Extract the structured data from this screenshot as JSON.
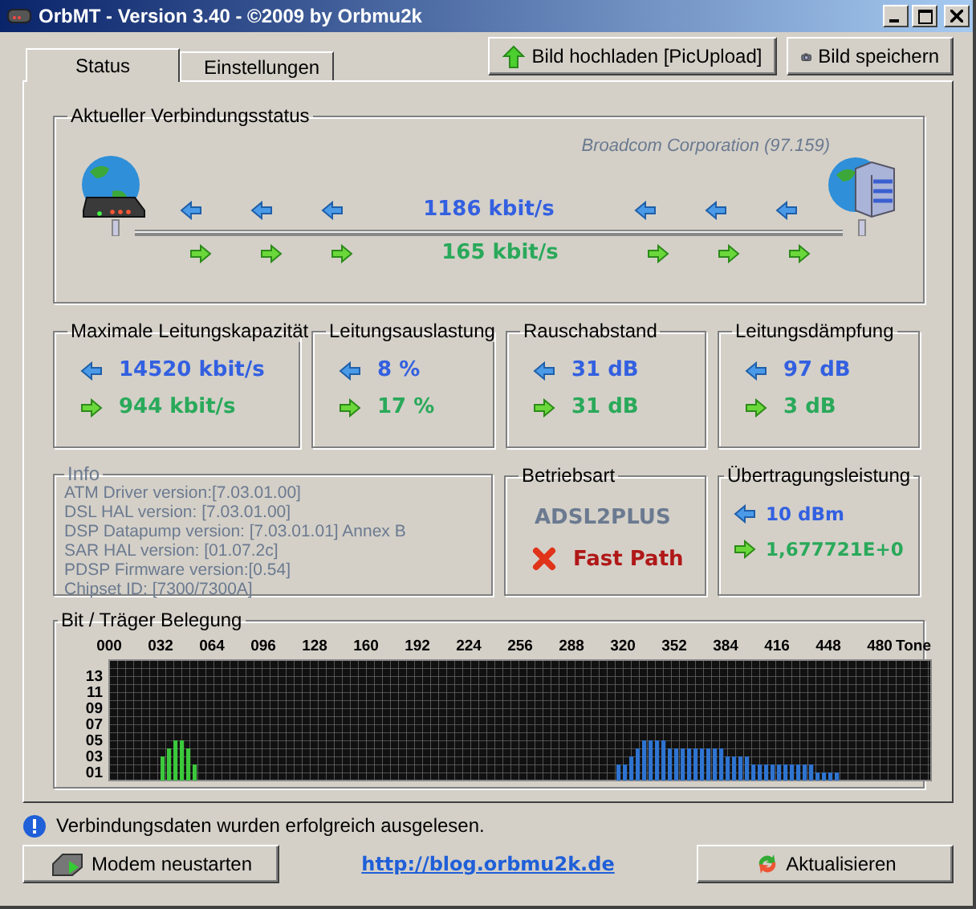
{
  "window": {
    "title": "OrbMT - Version 3.40 - ©2009 by Orbmu2k"
  },
  "tabs": [
    {
      "label": "Status",
      "selected": true
    },
    {
      "label": "Einstellungen",
      "selected": false
    }
  ],
  "toolbar_buttons": [
    {
      "label": "Bild hochladen [PicUpload]",
      "kind": "upload"
    },
    {
      "label": "Bild speichern",
      "kind": "camera"
    }
  ],
  "connection": {
    "title": "Aktueller Verbindungsstatus",
    "chipset": "Broadcom Corporation (97.159)",
    "downstream": "1186 kbit/s",
    "upstream": "165 kbit/s"
  },
  "metrics": [
    {
      "title": "Maximale Leitungskapazität",
      "down": "14520 kbit/s",
      "up": "944 kbit/s"
    },
    {
      "title": "Leitungsauslastung",
      "down": "8 %",
      "up": "17 %"
    },
    {
      "title": "Rauschabstand",
      "down": "31 dB",
      "up": "31 dB"
    },
    {
      "title": "Leitungsdämpfung",
      "down": "97 dB",
      "up": "3 dB"
    }
  ],
  "info": {
    "title": "Info",
    "lines": [
      "ATM Driver version:[7.03.01.00]",
      "DSL HAL version: [7.03.01.00]",
      "DSP Datapump version: [7.03.01.01] Annex B",
      "SAR HAL version: [01.07.2c]",
      "PDSP Firmware version:[0.54]",
      "Chipset ID: [7300/7300A]"
    ]
  },
  "operating_mode": {
    "title": "Betriebsart",
    "mode": "ADSL2PLUS",
    "path_label": "Fast Path",
    "path_enabled": false
  },
  "transmit_power": {
    "title": "Übertragungsleistung",
    "down": "10 dBm",
    "up": "1,677721E+0"
  },
  "bit_loading": {
    "title": "Bit / Träger Belegung",
    "chart_data": {
      "type": "bar",
      "xlabel": "Tone",
      "x": [
        32,
        36,
        40,
        44,
        48,
        52,
        316,
        320,
        324,
        328,
        332,
        336,
        340,
        344,
        348,
        352,
        356,
        360,
        364,
        368,
        372,
        376,
        380,
        384,
        388,
        392,
        396,
        400,
        404,
        408,
        412,
        416,
        420,
        424,
        428,
        432,
        436,
        440,
        444,
        448,
        452
      ],
      "series": [
        {
          "color": "#3cc83c",
          "values": [
            3,
            4,
            5,
            5,
            4,
            2,
            null,
            null,
            null,
            null,
            null,
            null,
            null,
            null,
            null,
            null,
            null,
            null,
            null,
            null,
            null,
            null,
            null,
            null,
            null,
            null,
            null,
            null,
            null,
            null,
            null,
            null,
            null,
            null,
            null,
            null,
            null,
            null,
            null,
            null,
            null
          ]
        },
        {
          "color": "#2f74d0",
          "values": [
            null,
            null,
            null,
            null,
            null,
            null,
            2,
            2,
            3,
            4,
            5,
            5,
            5,
            5,
            4,
            4,
            4,
            4,
            4,
            4,
            4,
            4,
            4,
            3,
            3,
            3,
            3,
            2,
            2,
            2,
            2,
            2,
            2,
            2,
            2,
            2,
            2,
            1,
            1,
            1,
            1
          ]
        }
      ],
      "xlim": [
        0,
        512
      ],
      "ylim": [
        0,
        15
      ],
      "xticks": [
        {
          "value": 0,
          "label": "000"
        },
        {
          "value": 32,
          "label": "032"
        },
        {
          "value": 64,
          "label": "064"
        },
        {
          "value": 96,
          "label": "096"
        },
        {
          "value": 128,
          "label": "128"
        },
        {
          "value": 160,
          "label": "160"
        },
        {
          "value": 192,
          "label": "192"
        },
        {
          "value": 224,
          "label": "224"
        },
        {
          "value": 256,
          "label": "256"
        },
        {
          "value": 288,
          "label": "288"
        },
        {
          "value": 320,
          "label": "320"
        },
        {
          "value": 352,
          "label": "352"
        },
        {
          "value": 384,
          "label": "384"
        },
        {
          "value": 416,
          "label": "416"
        },
        {
          "value": 448,
          "label": "448"
        },
        {
          "value": 480,
          "label": "480"
        }
      ],
      "yticks": [
        {
          "value": 1,
          "label": "01"
        },
        {
          "value": 3,
          "label": "03"
        },
        {
          "value": 5,
          "label": "05"
        },
        {
          "value": 7,
          "label": "07"
        },
        {
          "value": 9,
          "label": "09"
        },
        {
          "value": 11,
          "label": "11"
        },
        {
          "value": 13,
          "label": "13"
        }
      ]
    }
  },
  "status_message": "Verbindungsdaten wurden erfolgreich ausgelesen.",
  "footer": {
    "restart_button": "Modem neustarten",
    "link": "http://blog.orbmu2k.de",
    "refresh_button": "Aktualisieren"
  }
}
